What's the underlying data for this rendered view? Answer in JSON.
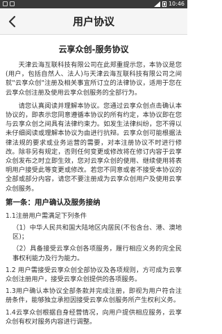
{
  "status_bar": {
    "time": "10:46"
  },
  "header": {
    "title": "用户协议",
    "back_icon": "chevron-left-icon"
  },
  "agreement": {
    "title": "云享众创-服务协议",
    "paragraphs": [
      "天津云海互联科技有限公司在此郑重提示您，本协议是您(用户，包括自然人、法人)与天津云海互联科技有限公司之间就\"云享众创\"注册及相关事宜所订立的法律协议，适用于您在云享众创注册及使用云享众创服务的全部行为。",
      "请您认真阅读并理解本协议。您通过云享众创点击确认本协议的，即表示您同意遵循本协议的所有约定，本协议即在您与云享众创之间具有法律约束力。如发生法律纠纷，您不得以未仔细阅读或理解本协议为由进行抗辩。云享众创可能根据法律法规的要求或业务运营的需要，对本注册协议不时进行修改。除非另有规定，否则任何变更或修改将在修订内容于云享众创发布之时立即生效，您对云享众创的使用、继续使用将表明用户接受此等变更或修改。若您不同意或者不接受本协议的全部或部分内容，请您不要注册成为云享众创用户及使用云享众创服务。"
    ],
    "section1": {
      "title": "第一条：用户确认及服务接纳",
      "items": [
        {
          "text": "1.1注册用户需满足下列条件",
          "indent": false
        },
        {
          "text": "（1）中华人民共和国大陆地区内居民(不包含台、港、澳地区)；",
          "indent": true
        },
        {
          "text": "（2）具备接受云享众创各项服务，履行相应义务的完全民事权利能力及行为能力。",
          "indent": true
        },
        {
          "text": "1.2 用户需接受云享众创全部协议及各项规则，方可成为云享众创注册用户，接受云享众创提供的各项服务。",
          "indent": false
        },
        {
          "text": "1.3用户确认本协议全部条款并完成注册，即视为用户符合注册条件，能够独立承担因接受云享众创服务所产生权利义务。",
          "indent": false
        },
        {
          "text": "1.4云享众创根据自身经营情况，向用户提供相应服务，云享众创有权对服务内容进行调整。",
          "indent": false
        }
      ]
    }
  }
}
